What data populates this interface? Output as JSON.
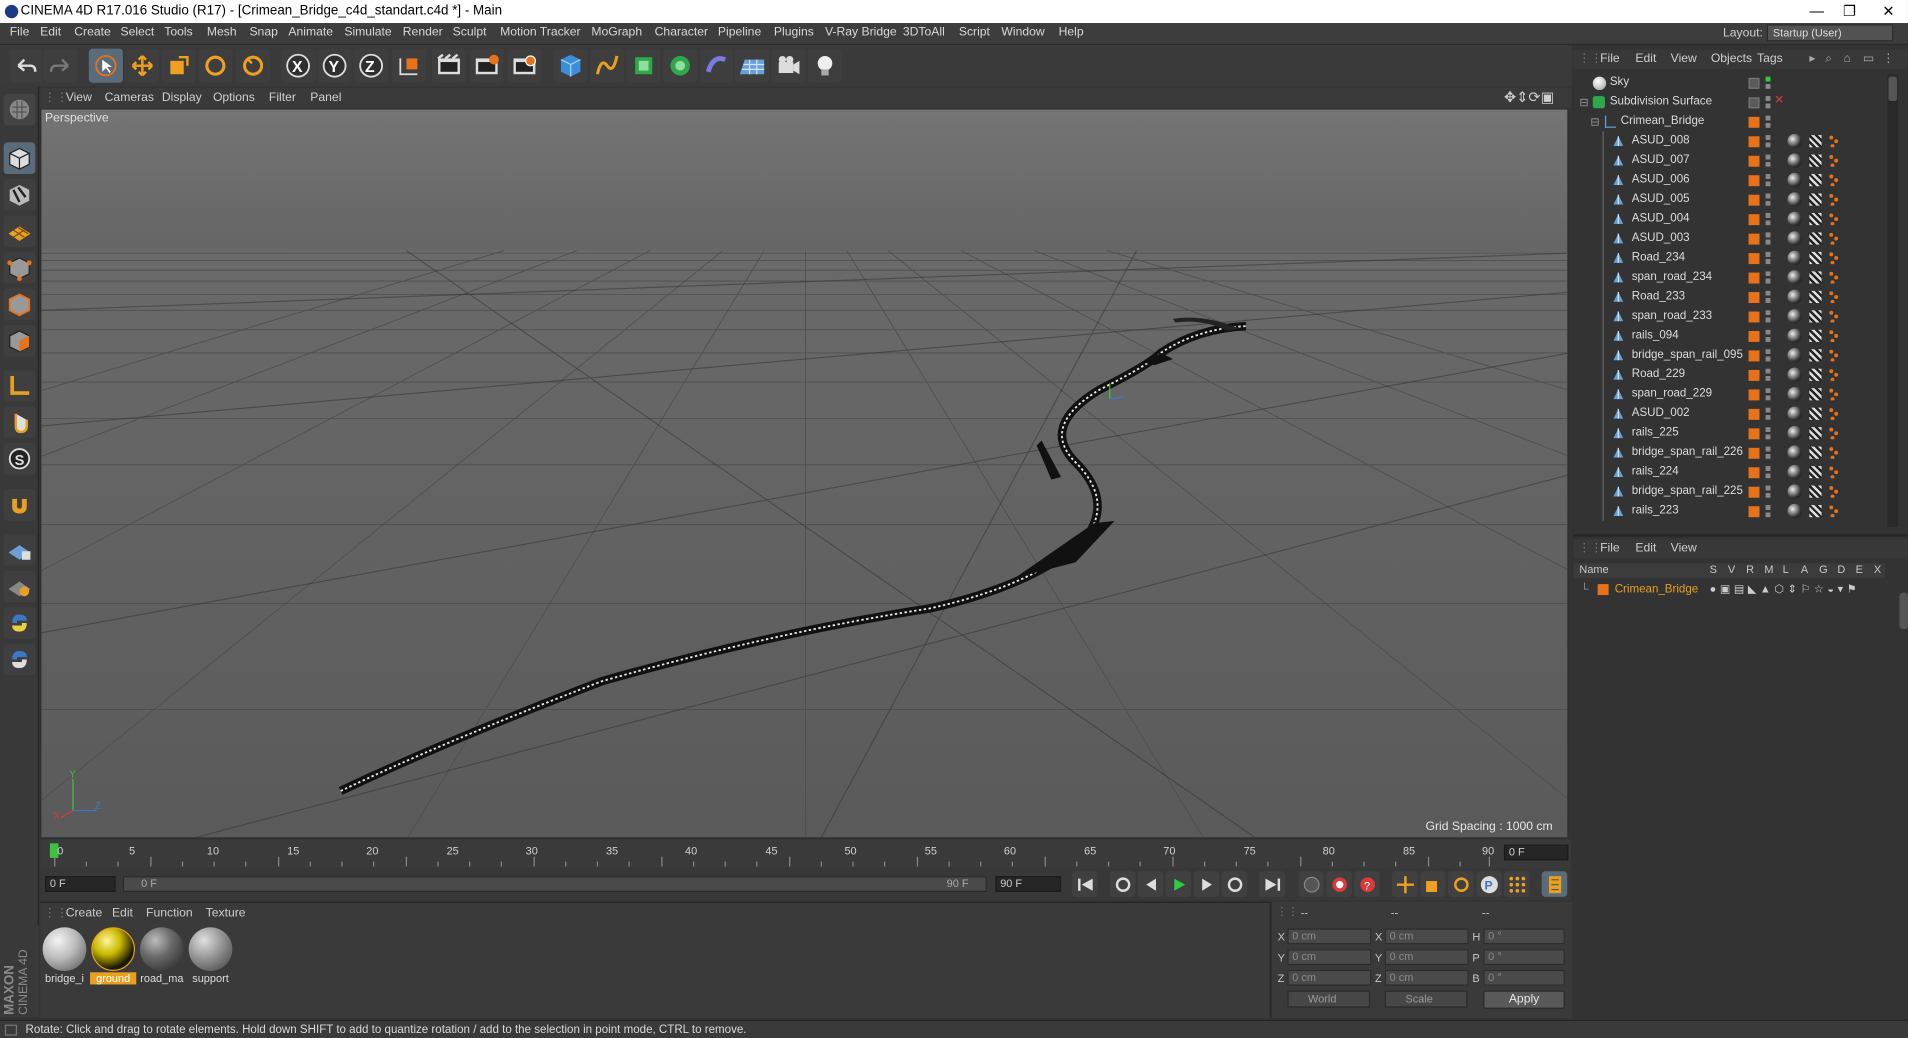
{
  "window": {
    "title": "CINEMA 4D R17.016 Studio (R17) - [Crimean_Bridge_c4d_standart.c4d *] - Main",
    "controls": [
      "—",
      "❐",
      "✕"
    ]
  },
  "menubar": {
    "items": [
      "File",
      "Edit",
      "Create",
      "Select",
      "Tools",
      "Mesh",
      "Snap",
      "Animate",
      "Simulate",
      "Render",
      "Sculpt",
      "Motion Tracker",
      "MoGraph",
      "Character",
      "Pipeline",
      "Plugins",
      "V-Ray Bridge",
      "3DToAll",
      "Script",
      "Window",
      "Help"
    ],
    "layout_label": "Layout:",
    "layout_value": "Startup (User)"
  },
  "viewport": {
    "menu": [
      "View",
      "Cameras",
      "Display",
      "Options",
      "Filter",
      "Panel"
    ],
    "name": "Perspective",
    "grid_spacing": "Grid Spacing : 1000 cm"
  },
  "timeline": {
    "ticks": [
      "0",
      "5",
      "10",
      "15",
      "20",
      "25",
      "30",
      "35",
      "40",
      "45",
      "50",
      "55",
      "60",
      "65",
      "70",
      "75",
      "80",
      "85",
      "90"
    ],
    "current_frame": "0 F",
    "start_frame": "0 F",
    "range_start": "0 F",
    "range_end": "90 F",
    "end_frame": "90 F"
  },
  "material_panel": {
    "menu": [
      "Create",
      "Edit",
      "Function",
      "Texture"
    ],
    "materials": [
      {
        "label": "bridge_i",
        "color": "#b9b9b9",
        "selected": false
      },
      {
        "label": "ground",
        "color": "#c9b800",
        "selected": true
      },
      {
        "label": "road_ma",
        "color": "#6a6a6a",
        "selected": false
      },
      {
        "label": "support",
        "color": "#9b9b9b",
        "selected": false
      }
    ]
  },
  "coordinates": {
    "header": [
      "--",
      "--",
      "--"
    ],
    "rows": [
      {
        "a": "X",
        "av": "0 cm",
        "b": "X",
        "bv": "0 cm",
        "c": "H",
        "cv": "0 °"
      },
      {
        "a": "Y",
        "av": "0 cm",
        "b": "Y",
        "bv": "0 cm",
        "c": "P",
        "cv": "0 °"
      },
      {
        "a": "Z",
        "av": "0 cm",
        "b": "Z",
        "bv": "0 cm",
        "c": "B",
        "cv": "0 °"
      }
    ],
    "mode": "World",
    "scale": "Scale",
    "apply": "Apply"
  },
  "object_manager": {
    "menu": [
      "File",
      "Edit",
      "View",
      "Objects",
      "Tags"
    ],
    "objects": [
      {
        "name": "Sky",
        "level": 0,
        "type": "sky"
      },
      {
        "name": "Subdivision Surface",
        "level": 0,
        "type": "subdiv"
      },
      {
        "name": "Crimean_Bridge",
        "level": 1,
        "type": "null"
      },
      {
        "name": "ASUD_008",
        "level": 2,
        "type": "mesh"
      },
      {
        "name": "ASUD_007",
        "level": 2,
        "type": "mesh"
      },
      {
        "name": "ASUD_006",
        "level": 2,
        "type": "mesh"
      },
      {
        "name": "ASUD_005",
        "level": 2,
        "type": "mesh"
      },
      {
        "name": "ASUD_004",
        "level": 2,
        "type": "mesh"
      },
      {
        "name": "ASUD_003",
        "level": 2,
        "type": "mesh"
      },
      {
        "name": "Road_234",
        "level": 2,
        "type": "mesh"
      },
      {
        "name": "span_road_234",
        "level": 2,
        "type": "mesh"
      },
      {
        "name": "Road_233",
        "level": 2,
        "type": "mesh"
      },
      {
        "name": "span_road_233",
        "level": 2,
        "type": "mesh"
      },
      {
        "name": "rails_094",
        "level": 2,
        "type": "mesh"
      },
      {
        "name": "bridge_span_rail_095",
        "level": 2,
        "type": "mesh"
      },
      {
        "name": "Road_229",
        "level": 2,
        "type": "mesh"
      },
      {
        "name": "span_road_229",
        "level": 2,
        "type": "mesh"
      },
      {
        "name": "ASUD_002",
        "level": 2,
        "type": "mesh"
      },
      {
        "name": "rails_225",
        "level": 2,
        "type": "mesh"
      },
      {
        "name": "bridge_span_rail_226",
        "level": 2,
        "type": "mesh"
      },
      {
        "name": "rails_224",
        "level": 2,
        "type": "mesh"
      },
      {
        "name": "bridge_span_rail_225",
        "level": 2,
        "type": "mesh"
      },
      {
        "name": "rails_223",
        "level": 2,
        "type": "mesh"
      }
    ]
  },
  "layer_manager": {
    "menu": [
      "File",
      "Edit",
      "View"
    ],
    "columns": [
      "Name",
      "S",
      "V",
      "R",
      "M",
      "L",
      "A",
      "G",
      "D",
      "E",
      "X"
    ],
    "rows": [
      {
        "name": "Crimean_Bridge"
      }
    ]
  },
  "status": "Rotate: Click and drag to rotate elements. Hold down SHIFT to add to quantize rotation / add to the selection in point mode, CTRL to remove.",
  "brand": {
    "line1": "MAXON",
    "line2": "CINEMA 4D"
  },
  "colors": {
    "accent_orange": "#e8721a",
    "selection_green": "#3ec23e",
    "play_green": "#2ecc40",
    "record_red": "#d93a3a"
  }
}
